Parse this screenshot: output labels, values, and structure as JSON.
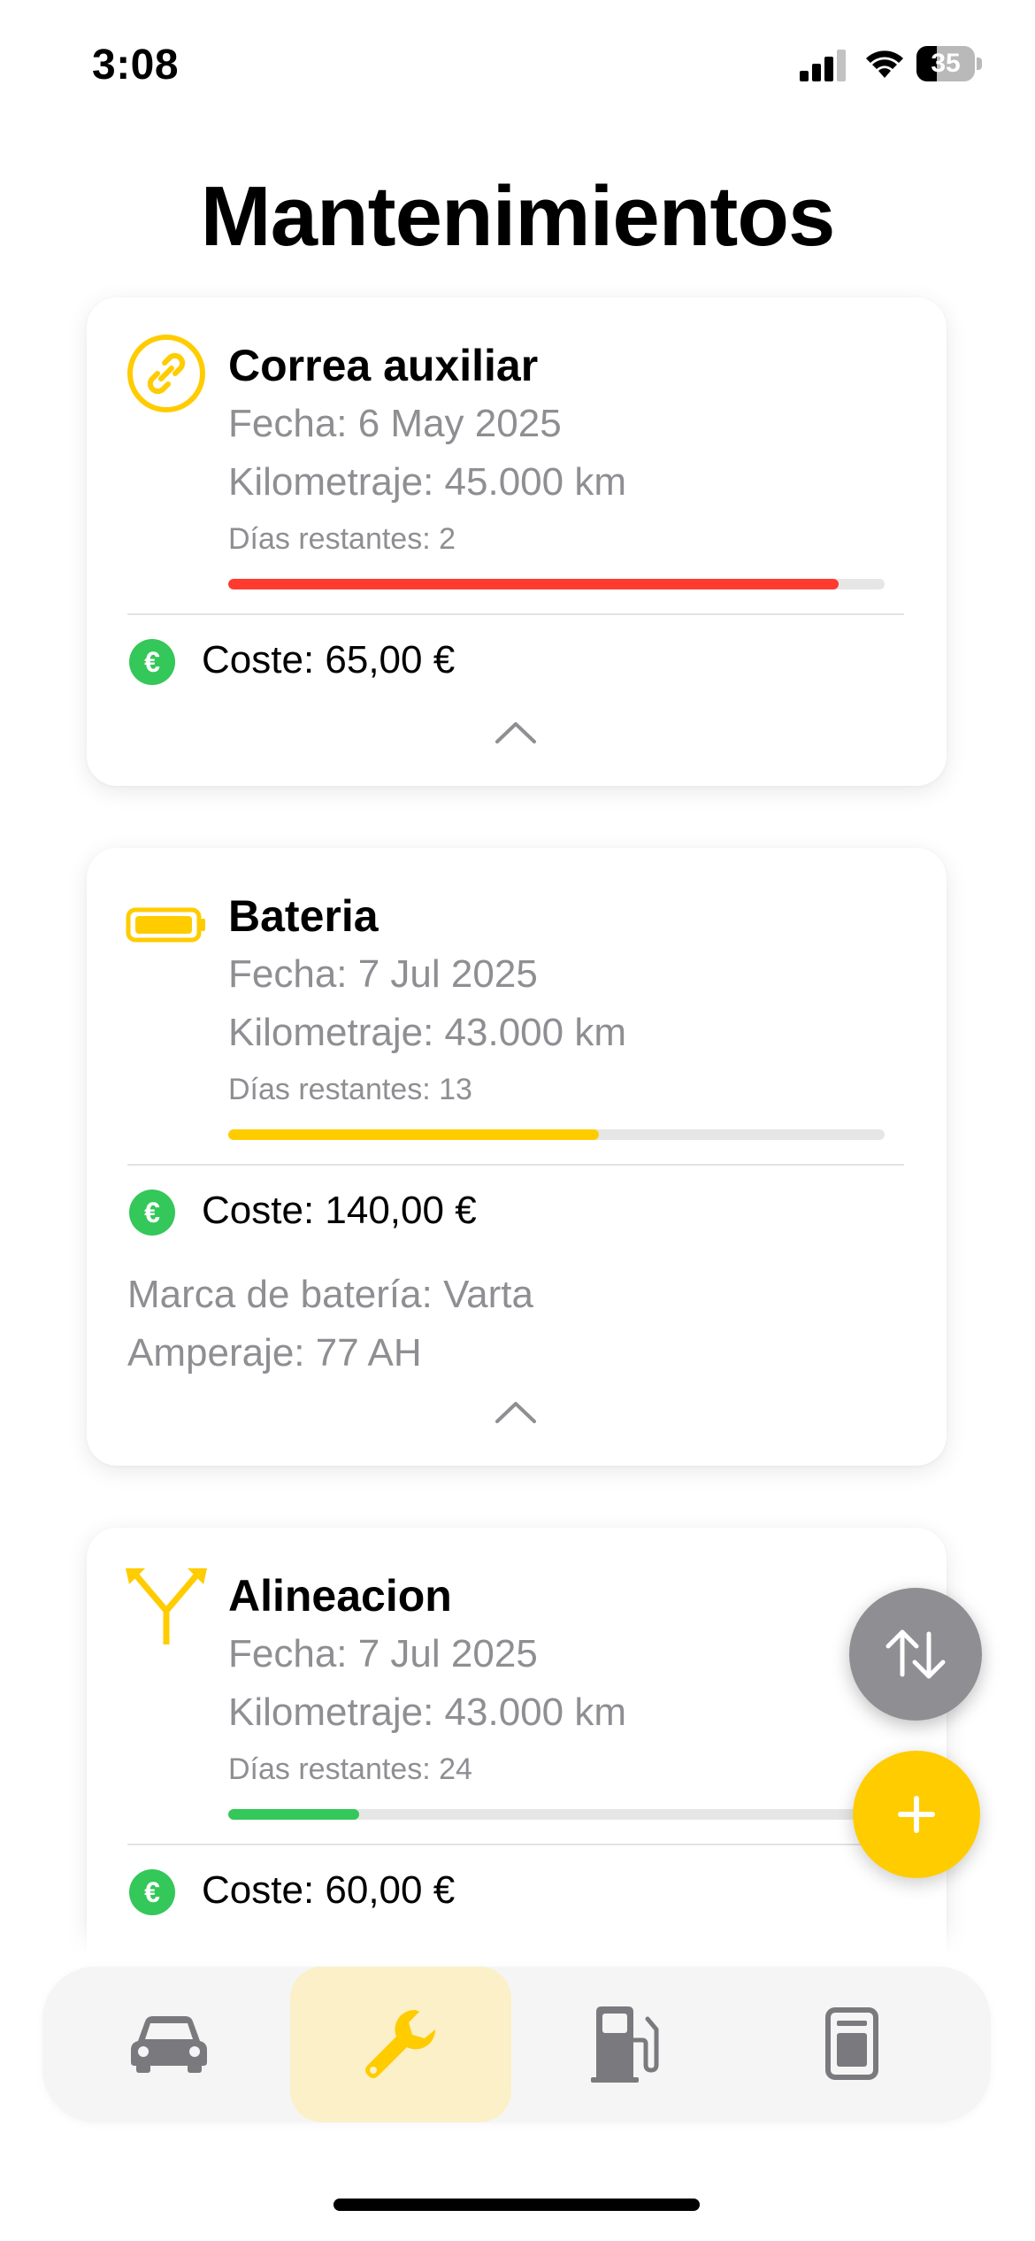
{
  "status_bar": {
    "time": "3:08",
    "battery_percent": 35,
    "battery_label": "35",
    "icons": [
      "signal-icon",
      "wifi-icon",
      "battery-icon"
    ]
  },
  "page": {
    "title": "Mantenimientos"
  },
  "colors": {
    "accent": "#ffcc00",
    "urgent": "#ff3b30",
    "ok": "#34c759",
    "secondary_text": "#8e8e93",
    "tab_active_bg": "#fbf0c8"
  },
  "cards": [
    {
      "icon": "link-icon",
      "title": "Correa auxiliar",
      "date": "Fecha: 6 May 2025",
      "mileage": "Kilometraje: 45.000 km",
      "days_left": "Días restantes: 2",
      "progress": 0.93,
      "progress_color": "#ff3b30",
      "cost": "Coste: 65,00 €",
      "extras": [],
      "expanded": true
    },
    {
      "icon": "battery-icon",
      "title": "Bateria",
      "date": "Fecha: 7 Jul 2025",
      "mileage": "Kilometraje: 43.000 km",
      "days_left": "Días restantes: 13",
      "progress": 0.565,
      "progress_color": "#ffcc00",
      "cost": "Coste: 140,00 €",
      "extras": [
        "Marca de batería: Varta",
        "Amperaje: 77 AH"
      ],
      "expanded": true
    },
    {
      "icon": "alignment-icon",
      "title": "Alineacion",
      "date": "Fecha: 7 Jul 2025",
      "mileage": "Kilometraje: 43.000 km",
      "days_left": "Días restantes: 24",
      "progress": 0.2,
      "progress_color": "#34c759",
      "cost": "Coste: 60,00 €",
      "extras": [],
      "expanded": true
    }
  ],
  "currency_symbol": "€",
  "fabs": {
    "sort_icon": "sort-arrows-icon",
    "add_icon": "plus-icon"
  },
  "tab_bar": {
    "active_index": 1,
    "tabs": [
      {
        "icon": "car-icon"
      },
      {
        "icon": "wrench-icon"
      },
      {
        "icon": "fuel-pump-icon"
      },
      {
        "icon": "document-icon"
      }
    ]
  }
}
